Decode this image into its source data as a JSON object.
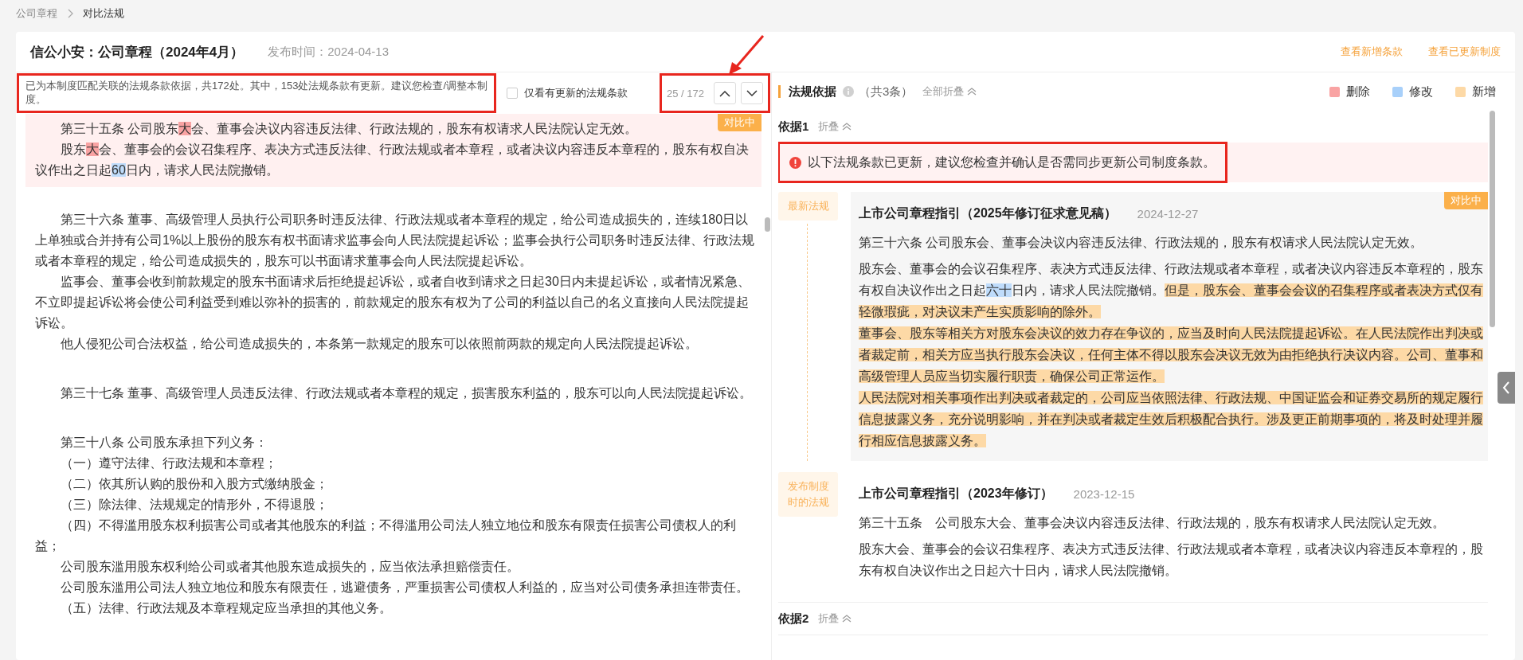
{
  "breadcrumb": [
    {
      "label": "公司章程",
      "current": false
    },
    {
      "label": "对比法规",
      "current": true
    }
  ],
  "header": {
    "title": "信公小安：公司章程（2024年4月）",
    "date": "发布时间：2024-04-13",
    "links": [
      "查看新增条款",
      "查看已更新制度"
    ]
  },
  "left": {
    "banner": {
      "text": "已为本制度匹配关联的法规条款依据，共172处。其中，153处法规条款有更新。建议您检查/调整本制度。",
      "marked": true
    },
    "filter": {
      "label": "仅看有更新的法规条款",
      "checked": false
    },
    "pager": {
      "text": "25 / 172",
      "marked": true,
      "pointed": true
    },
    "blocks": [
      {
        "active": true,
        "badge": "对比中",
        "paragraphs": [
          {
            "segments": [
              {
                "text": "第三十五条  公司股东",
                "kind": "plain"
              },
              {
                "text": "大",
                "kind": "delete"
              },
              {
                "text": "会、董事会决议内容违反法律、行政法规的，股东有权请求人民法院认定无效。",
                "kind": "plain"
              }
            ]
          },
          {
            "segments": [
              {
                "text": "股东",
                "kind": "plain"
              },
              {
                "text": "大",
                "kind": "delete"
              },
              {
                "text": "会、董事会的会议召集程序、表决方式违反法律、行政法规或者本章程，或者决议内容违反本章程的，股东有权自决议作出之日起",
                "kind": "plain"
              },
              {
                "text": "60",
                "kind": "modify"
              },
              {
                "text": "日内，请求人民法院撤销。",
                "kind": "plain"
              }
            ]
          }
        ]
      },
      {
        "active": false,
        "paragraphs": [
          {
            "segments": [
              {
                "text": "第三十六条  董事、高级管理人员执行公司职务时违反法律、行政法规或者本章程的规定，给公司造成损失的，连续180日以上单独或合并持有公司1%以上股份的股东有权书面请求监事会向人民法院提起诉讼；监事会执行公司职务时违反法律、行政法规或者本章程的规定，给公司造成损失的，股东可以书面请求董事会向人民法院提起诉讼。",
                "kind": "plain"
              }
            ]
          },
          {
            "segments": [
              {
                "text": "监事会、董事会收到前款规定的股东书面请求后拒绝提起诉讼，或者自收到请求之日起30日内未提起诉讼，或者情况紧急、不立即提起诉讼将会使公司利益受到难以弥补的损害的，前款规定的股东有权为了公司的利益以自己的名义直接向人民法院提起诉讼。",
                "kind": "plain"
              }
            ]
          },
          {
            "segments": [
              {
                "text": "他人侵犯公司合法权益，给公司造成损失的，本条第一款规定的股东可以依照前两款的规定向人民法院提起诉讼。",
                "kind": "plain"
              }
            ]
          }
        ]
      },
      {
        "active": false,
        "paragraphs": [
          {
            "segments": [
              {
                "text": "第三十七条  董事、高级管理人员违反法律、行政法规或者本章程的规定，损害股东利益的，股东可以向人民法院提起诉讼。",
                "kind": "plain"
              }
            ]
          }
        ]
      },
      {
        "active": false,
        "paragraphs": [
          {
            "segments": [
              {
                "text": "第三十八条  公司股东承担下列义务：",
                "kind": "plain"
              }
            ]
          },
          {
            "segments": [
              {
                "text": "（一）遵守法律、行政法规和本章程；",
                "kind": "plain"
              }
            ]
          },
          {
            "segments": [
              {
                "text": "（二）依其所认购的股份和入股方式缴纳股金；",
                "kind": "plain"
              }
            ]
          },
          {
            "segments": [
              {
                "text": "（三）除法律、法规规定的情形外，不得退股；",
                "kind": "plain"
              }
            ]
          },
          {
            "segments": [
              {
                "text": "（四）不得滥用股东权利损害公司或者其他股东的利益；不得滥用公司法人独立地位和股东有限责任损害公司债权人的利益；",
                "kind": "plain"
              }
            ]
          },
          {
            "segments": [
              {
                "text": "公司股东滥用股东权利给公司或者其他股东造成损失的，应当依法承担赔偿责任。",
                "kind": "plain"
              }
            ]
          },
          {
            "segments": [
              {
                "text": "公司股东滥用公司法人独立地位和股东有限责任，逃避债务，严重损害公司债权人利益的，应当对公司债务承担连带责任。",
                "kind": "plain"
              }
            ]
          },
          {
            "segments": [
              {
                "text": "（五）法律、行政法规及本章程规定应当承担的其他义务。",
                "kind": "plain"
              }
            ]
          }
        ]
      }
    ]
  },
  "right": {
    "title": "法规依据",
    "count": "（共3条）",
    "collapse_all": "全部折叠",
    "legend": [
      {
        "label": "删除",
        "color": "#f9a3a3"
      },
      {
        "label": "修改",
        "color": "#a8d0fa"
      },
      {
        "label": "新增",
        "color": "#fdd9a6"
      }
    ],
    "bases": [
      {
        "title": "依据1",
        "toggle": "折叠",
        "alert": {
          "text": "以下法规条款已更新，建议您检查并确认是否需同步更新公司制度条款。",
          "marked": true
        },
        "entries": [
          {
            "tag": "最新法规",
            "title": "上市公司章程指引（2025年修订征求意见稿）",
            "date": "2024-12-27",
            "badge": "对比中",
            "paragraphs": [
              {
                "segments": [
                  {
                    "text": "第三十六条 公司股东会、董事会决议内容违反法律、行政法规的，股东有权请求人民法院认定无效。",
                    "kind": "plain"
                  }
                ]
              },
              {
                "segments": [
                  {
                    "text": "股东会、董事会的会议召集程序、表决方式违反法律、行政法规或者本章程，或者决议内容违反本章程的，股东有权自决议作出之日起",
                    "kind": "plain"
                  },
                  {
                    "text": "六十",
                    "kind": "modify"
                  },
                  {
                    "text": "日内，请求人民法院撤销。",
                    "kind": "plain"
                  },
                  {
                    "text": "但是，股东会、董事会会议的召集程序或者表决方式仅有轻微瑕疵，对决议未产生实质影响的除外。",
                    "kind": "add"
                  },
                  {
                    "text": "董事会、股东等相关方对股东会决议的效力存在争议的，应当及时向人民法院提起诉讼。在人民法院作出判决或者裁定前，相关方应当执行股东会决议，任何主体不得以股东会决议无效为由拒绝执行决议内容。公司、董事和高级管理人员应当切实履行职责，确保公司正常运作。",
                    "kind": "add",
                    "break": true
                  },
                  {
                    "text": "人民法院对相关事项作出判决或者裁定的，公司应当依照法律、行政法规、中国证监会和证券交易所的规定履行信息披露义务，充分说明影响，并在判决或者裁定生效后积极配合执行。涉及更正前期事项的，将及时处理并履行相应信息披露义务。",
                    "kind": "add",
                    "break": true
                  }
                ]
              }
            ]
          },
          {
            "tag": "发布制度时的法规",
            "title": "上市公司章程指引（2023年修订）",
            "date": "2023-12-15",
            "paragraphs": [
              {
                "segments": [
                  {
                    "text": "第三十五条　公司股东大会、董事会决议内容违反法律、行政法规的，股东有权请求人民法院认定无效。",
                    "kind": "plain"
                  }
                ]
              },
              {
                "segments": [
                  {
                    "text": "股东大会、董事会的会议召集程序、表决方式违反法律、行政法规或者本章程，或者决议内容违反本章程的，股东有权自决议作出之日起六十日内，请求人民法院撤销。",
                    "kind": "plain"
                  }
                ]
              }
            ]
          }
        ]
      },
      {
        "title": "依据2",
        "toggle": "折叠"
      }
    ]
  }
}
